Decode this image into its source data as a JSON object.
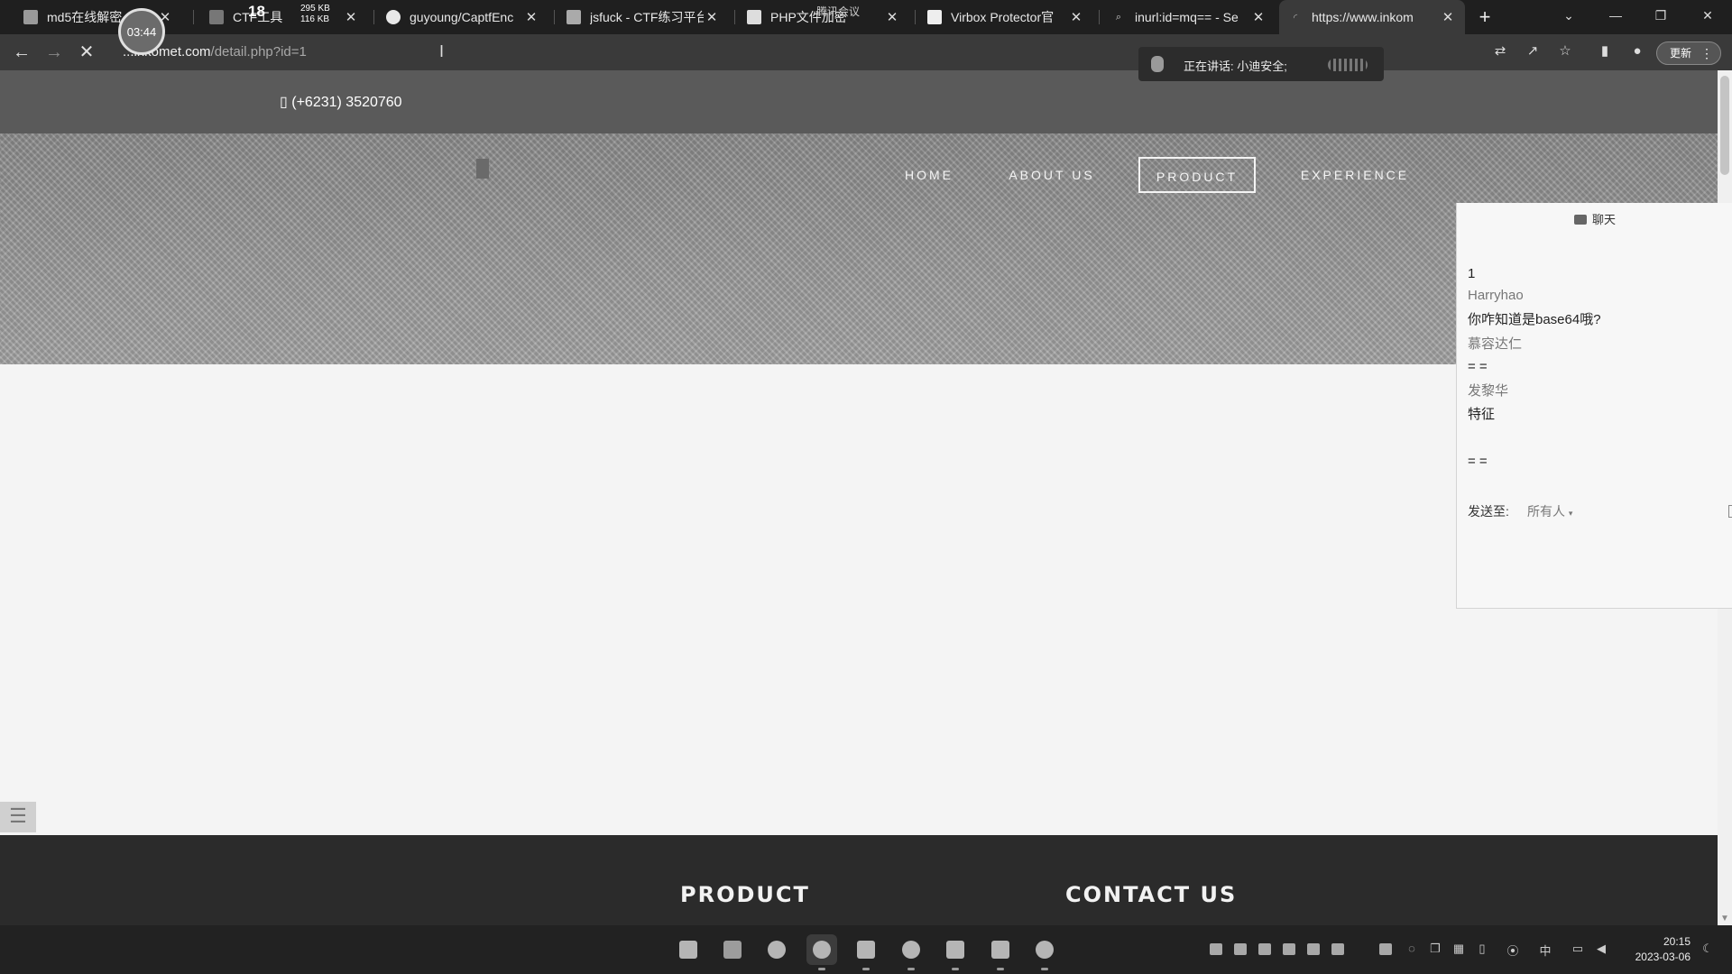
{
  "browser": {
    "tabs": [
      {
        "title": "md5在线解密",
        "icon": "page-icon"
      },
      {
        "title": "CTF工具",
        "icon": "shield-icon"
      },
      {
        "title": "guyoung/CaptfEnc",
        "icon": "github-icon"
      },
      {
        "title": "jsfuck - CTF练习平台",
        "icon": "page-icon"
      },
      {
        "title": "PHP文件加密",
        "icon": "page-icon"
      },
      {
        "title": "Virbox Protector官",
        "icon": "page-icon"
      },
      {
        "title": "inurl:id=mq== - Se",
        "icon": "search-icon"
      },
      {
        "title": "https://www.inkom",
        "icon": "loading-icon"
      }
    ],
    "address": {
      "host": "...inkomet.com",
      "path": "/detail.php?id=1"
    },
    "update_label": "更新"
  },
  "overlays": {
    "timer": "03:44",
    "net_counter": "18",
    "net_up": "295 KB",
    "net_down": "116 KB",
    "meeting_label": "腾讯会议",
    "speaking": "正在讲话: 小迪安全;"
  },
  "site": {
    "phone": "(+6231) 3520760",
    "nav": [
      "HOME",
      "ABOUT US",
      "PRODUCT",
      "EXPERIENCE"
    ],
    "active_nav": "PRODUCT",
    "footer": {
      "product": "PRODUCT",
      "contact": "CONTACT US"
    }
  },
  "chat": {
    "title": "聊天",
    "messages": [
      {
        "text": "1",
        "sender": false
      },
      {
        "text": "Harryhao",
        "sender": true
      },
      {
        "text": "你咋知道是base64哦?",
        "sender": false
      },
      {
        "text": "慕容达仁",
        "sender": true
      },
      {
        "text": "= =",
        "sender": false
      },
      {
        "text": "发黎华",
        "sender": true
      },
      {
        "text": "特征",
        "sender": false
      },
      {
        "text": "= =",
        "sender": false
      }
    ],
    "send_to_label": "发送至:",
    "recipients": "所有人"
  },
  "taskbar": {
    "time": "20:15",
    "date": "2023-03-06",
    "ime": "中"
  }
}
